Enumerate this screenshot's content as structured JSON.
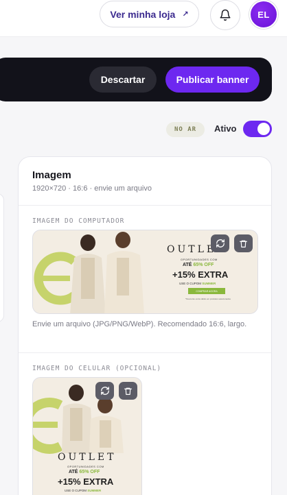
{
  "header": {
    "store_link_label": "Ver minha loja",
    "avatar_initials": "EL"
  },
  "actions": {
    "discard_label": "Descartar",
    "publish_label": "Publicar banner"
  },
  "status": {
    "offline_badge": "NO AR",
    "active_label": "Ativo",
    "active": true
  },
  "card": {
    "title": "Imagem",
    "subtitle": "1920×720 · 16:6 · envie um arquivo",
    "desktop_section_label": "IMAGEM DO COMPUTADOR",
    "desktop_hint": "Envie um arquivo (JPG/PNG/WebP). Recomendado 16:6, largo.",
    "mobile_section_label": "IMAGEM DO CELULAR (OPCIONAL)"
  },
  "banner": {
    "brand": "OUTLET",
    "line1": "OPORTUNIDADES COM",
    "line2_prefix": "ATÉ",
    "line2_highlight": "65% OFF",
    "extra": "+15% EXTRA",
    "coupon_prefix": "USE O CUPOM",
    "coupon_code": "SUMMER",
    "cta": "COMPRAR AGORA",
    "fine_print": "*Desconto extra válido em produtos selecionados"
  },
  "colors": {
    "accent": "#6d28f0",
    "dark_bar": "#12121a",
    "banner_bg": "#f3ede3",
    "banner_green": "#c6d36b"
  },
  "icons": [
    "external-link-icon",
    "bell-icon",
    "replace-icon",
    "trash-icon"
  ]
}
